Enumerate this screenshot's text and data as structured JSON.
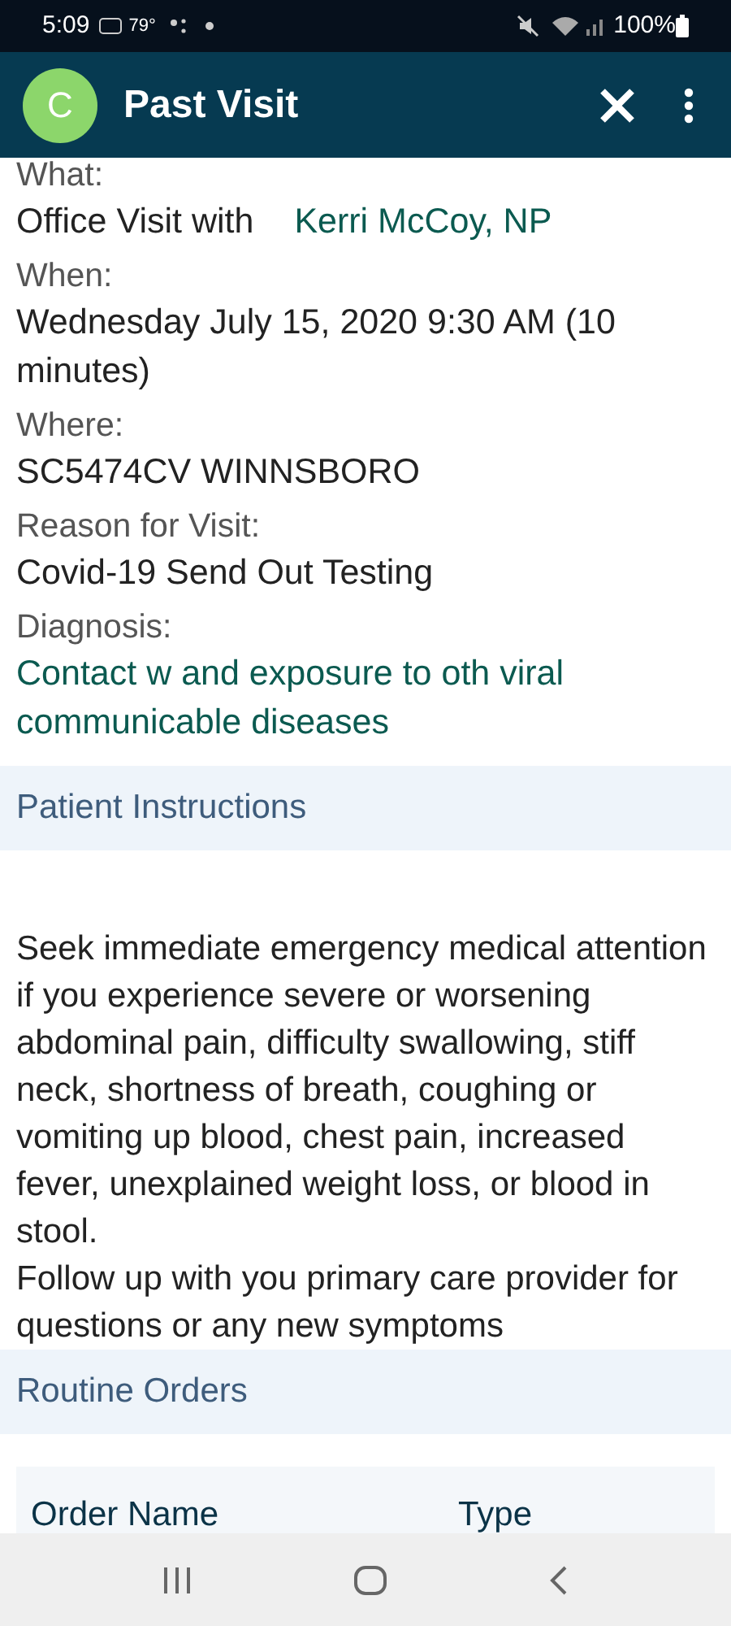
{
  "status_bar": {
    "time": "5:09",
    "temperature": "79°",
    "battery": "100%"
  },
  "header": {
    "avatar_letter": "C",
    "title": "Past Visit"
  },
  "details": [
    {
      "label": "What:",
      "value": "Office Visit with",
      "link": "Kerri McCoy, NP"
    },
    {
      "label": "When:",
      "value": "Wednesday July 15, 2020 9:30 AM (10 minutes)"
    },
    {
      "label": "Where:",
      "value": "SC5474CV WINNSBORO"
    },
    {
      "label": "Reason for Visit:",
      "value": "Covid-19 Send Out Testing"
    },
    {
      "label": "Diagnosis:",
      "link": "Contact w and exposure to oth viral communicable diseases"
    }
  ],
  "patient_instructions": {
    "title": "Patient Instructions",
    "paragraphs": [
      "Seek immediate emergency medical attention if you experience severe or worsening abdominal pain, difficulty swallowing, stiff neck, shortness of breath, coughing or vomiting up blood, chest pain, increased fever, unexplained weight loss, or blood in stool.",
      "Follow up with you primary care provider for questions or any new symptoms"
    ]
  },
  "routine_orders": {
    "title": "Routine Orders",
    "columns": [
      "Order Name",
      "Type"
    ]
  }
}
